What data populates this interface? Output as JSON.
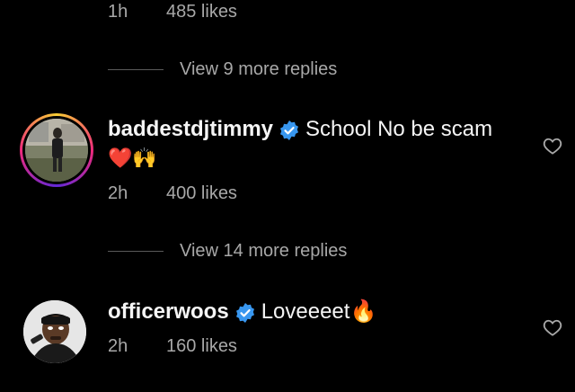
{
  "top_comment": {
    "time": "1h",
    "likes": "485 likes"
  },
  "view_more_1": {
    "label": "View 9 more replies"
  },
  "comment_1": {
    "username": "baddestdjtimmy",
    "text": "School No be scam",
    "emoji_line": "❤️🙌",
    "time": "2h",
    "likes": "400 likes",
    "icons": {
      "verified": "verified-badge-icon",
      "like": "heart-outline-icon"
    }
  },
  "view_more_2": {
    "label": "View 14 more replies"
  },
  "comment_2": {
    "username": "officerwoos",
    "text": "Loveeeet🔥",
    "time": "2h",
    "likes": "160 likes",
    "icons": {
      "verified": "verified-badge-icon",
      "like": "heart-outline-icon"
    }
  },
  "colors": {
    "background": "#000000",
    "text": "#f5f5f5",
    "muted": "#a8a8a8",
    "verified": "#3897f0",
    "heart": "#ed4956"
  }
}
